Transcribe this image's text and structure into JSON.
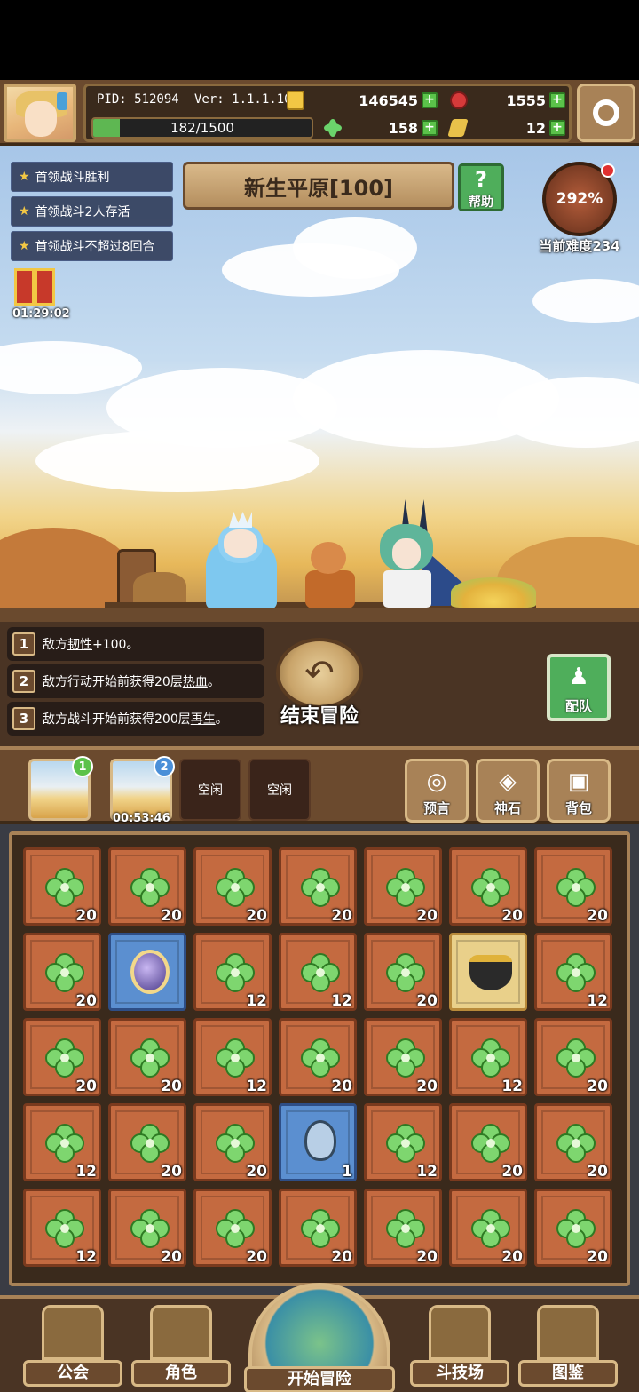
{
  "header": {
    "pid": "PID: 512094",
    "version": "Ver: 1.1.1.10",
    "gold": "146545",
    "red_gems": "1555",
    "exp": "182/1500",
    "exp_fraction": 0.121,
    "clovers": "158",
    "keys": "12"
  },
  "quests": [
    {
      "label": "首领战斗胜利"
    },
    {
      "label": "首领战斗2人存活"
    },
    {
      "label": "首领战斗不超过8回合"
    }
  ],
  "gift_timer": "01:29:02",
  "stage": {
    "title": "新生平原[100]",
    "help_label": "帮助"
  },
  "difficulty": {
    "percent": "292%",
    "label": "当前难度234"
  },
  "buffs": [
    {
      "num": "1",
      "pre": "敌方",
      "key": "韧性",
      "post": "+100。"
    },
    {
      "num": "2",
      "pre": "敌方行动开始前获得20层",
      "key": "热血",
      "post": "。"
    },
    {
      "num": "3",
      "pre": "敌方战斗开始前获得200层",
      "key": "再生",
      "post": "。"
    }
  ],
  "end_adventure_label": "结束冒险",
  "team_label": "配队",
  "slots": [
    {
      "badge": "1",
      "time": ""
    },
    {
      "badge": "2",
      "time": "00:53:46"
    },
    {
      "idle": "空闲"
    },
    {
      "idle": "空闲"
    }
  ],
  "tools": [
    {
      "label": "预言"
    },
    {
      "label": "神石"
    },
    {
      "label": "背包"
    }
  ],
  "inventory": [
    [
      "clover",
      "20"
    ],
    [
      "clover",
      "20"
    ],
    [
      "clover",
      "20"
    ],
    [
      "clover",
      "20"
    ],
    [
      "clover",
      "20"
    ],
    [
      "clover",
      "20"
    ],
    [
      "clover",
      "20"
    ],
    [
      "clover",
      "20"
    ],
    [
      "orb",
      ""
    ],
    [
      "clover",
      "12"
    ],
    [
      "clover",
      "12"
    ],
    [
      "clover",
      "20"
    ],
    [
      "cauldron",
      ""
    ],
    [
      "clover",
      "12"
    ],
    [
      "clover",
      "20"
    ],
    [
      "clover",
      "20"
    ],
    [
      "clover",
      "12"
    ],
    [
      "clover",
      "20"
    ],
    [
      "clover",
      "20"
    ],
    [
      "clover",
      "12"
    ],
    [
      "clover",
      "20"
    ],
    [
      "clover",
      "12"
    ],
    [
      "clover",
      "20"
    ],
    [
      "clover",
      "20"
    ],
    [
      "drop",
      "1"
    ],
    [
      "clover",
      "12"
    ],
    [
      "clover",
      "20"
    ],
    [
      "clover",
      "20"
    ],
    [
      "clover",
      "12"
    ],
    [
      "clover",
      "20"
    ],
    [
      "clover",
      "20"
    ],
    [
      "clover",
      "20"
    ],
    [
      "clover",
      "20"
    ],
    [
      "clover",
      "20"
    ],
    [
      "clover",
      "20"
    ]
  ],
  "nav": {
    "guild": "公会",
    "character": "角色",
    "start": "开始冒险",
    "arena": "斗技场",
    "codex": "图鉴"
  }
}
